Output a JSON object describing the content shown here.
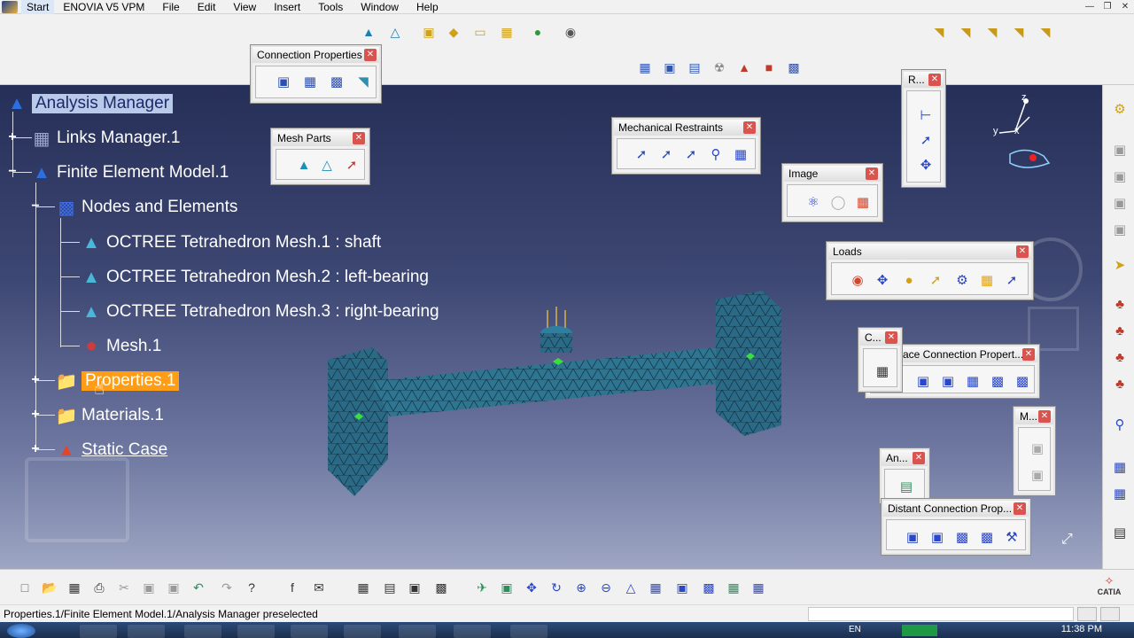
{
  "menubar": {
    "start": "Start",
    "items": [
      "ENOVIA V5 VPM",
      "File",
      "Edit",
      "View",
      "Insert",
      "Tools",
      "Window",
      "Help"
    ]
  },
  "tree": {
    "root": "Analysis Manager",
    "links_manager": "Links Manager.1",
    "fem": "Finite Element Model.1",
    "nodes": "Nodes and Elements",
    "mesh1": "OCTREE Tetrahedron Mesh.1 : shaft",
    "mesh2": "OCTREE Tetrahedron Mesh.2 : left-bearing",
    "mesh3": "OCTREE Tetrahedron Mesh.3 : right-bearing",
    "mesh": "Mesh.1",
    "properties": "Properties.1",
    "materials": "Materials.1",
    "static_case": "Static Case"
  },
  "panels": {
    "connection_properties": "Connection Properties",
    "mesh_parts": "Mesh Parts",
    "mechanical_restraints": "Mechanical Restraints",
    "image": "Image",
    "loads": "Loads",
    "r": "R...",
    "c": "C...",
    "face_connection": "ace Connection Propert...",
    "m": "M...",
    "an": "An...",
    "distant_connection": "Distant Connection Prop..."
  },
  "compass": {
    "x": "x",
    "y": "y",
    "z": "z"
  },
  "status": {
    "text": "Properties.1/Finite Element Model.1/Analysis Manager preselected"
  },
  "taskbar": {
    "time": "11:38 PM",
    "lang": "EN"
  },
  "brand": {
    "logo": "CATIA"
  },
  "colors": {
    "highlight_blue": "#b9c9e9",
    "highlight_orange": "#ff9d16",
    "mesh": "#2b6b86",
    "viewport_top": "#262f57"
  }
}
